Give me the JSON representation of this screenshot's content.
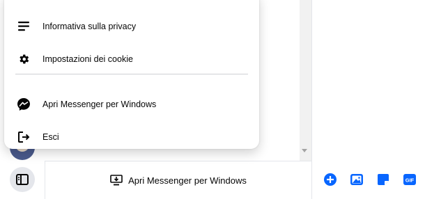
{
  "menu": {
    "items": [
      {
        "label": "Informativa sulla privacy",
        "icon": "lines-icon"
      },
      {
        "label": "Impostazioni dei cookie",
        "icon": "gear-icon"
      },
      {
        "label": "Apri Messenger per Windows",
        "icon": "messenger-icon"
      },
      {
        "label": "Esci",
        "icon": "logout-icon"
      }
    ]
  },
  "footer": {
    "open_app_label": "Apri Messenger per Windows"
  },
  "composer": {
    "icons": [
      "plus-icon",
      "image-icon",
      "sticker-icon",
      "gif-icon"
    ],
    "gif_text": "GIF",
    "accent": "#0866ff"
  }
}
